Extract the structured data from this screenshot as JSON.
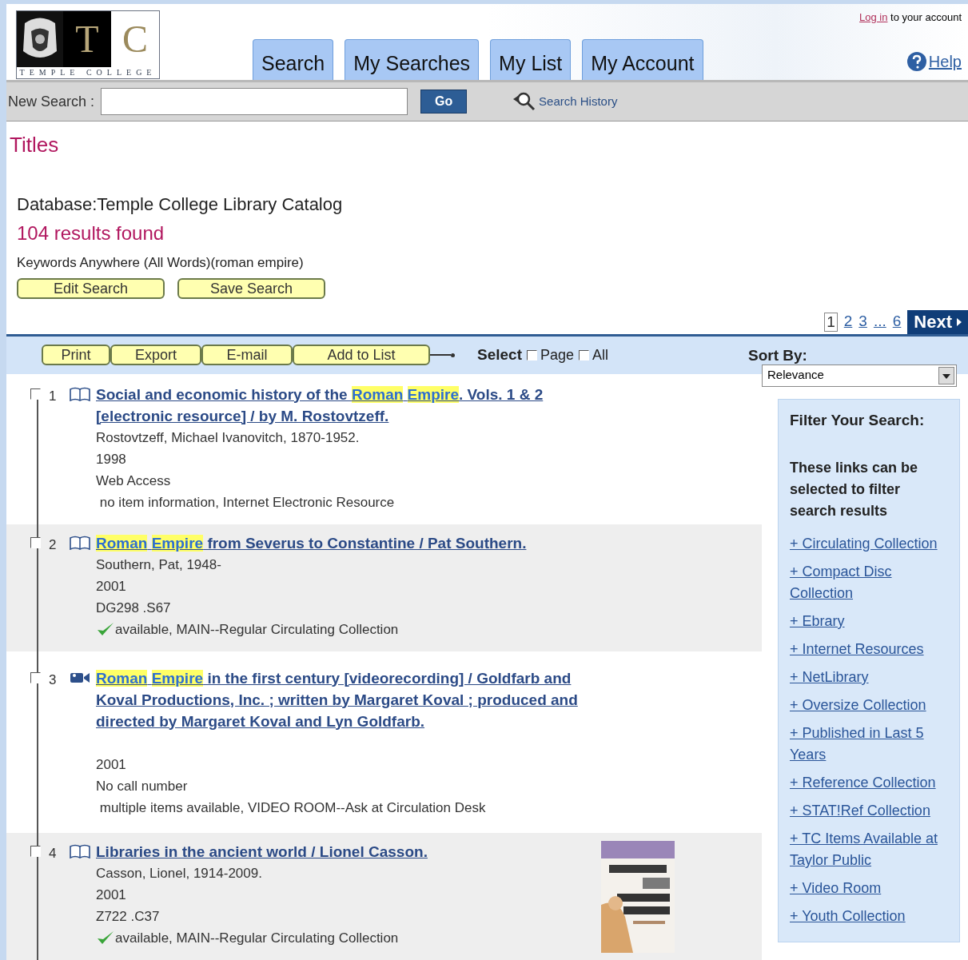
{
  "header": {
    "logo": {
      "initials": [
        "T",
        "C"
      ],
      "name": "TEMPLE COLLEGE"
    },
    "login_link": "Log in",
    "login_text": "to your account",
    "help": "Help"
  },
  "tabs": [
    {
      "label": "Search"
    },
    {
      "label": "My Searches"
    },
    {
      "label": "My List"
    },
    {
      "label": "My Account"
    }
  ],
  "search_bar": {
    "label": "New Search :",
    "go": "Go",
    "history": "Search History"
  },
  "page_title": "Titles",
  "database": "Database:Temple College Library Catalog",
  "results_count": "104 results found",
  "query": "Keywords Anywhere (All Words)(roman empire)",
  "query_buttons": [
    "Edit Search",
    "Save Search"
  ],
  "pagination": {
    "pages": [
      {
        "label": "1",
        "selected": true
      },
      {
        "label": "2",
        "selected": false
      },
      {
        "label": "3",
        "selected": false
      },
      {
        "label": "...",
        "selected": false
      },
      {
        "label": "6",
        "selected": false
      }
    ],
    "next": "Next"
  },
  "toolbar": {
    "actions": [
      "Print",
      "Export",
      "E-mail",
      "Add to List"
    ],
    "select_label": "Select",
    "checkboxes": [
      {
        "label": "Page",
        "checked": false
      },
      {
        "label": "All",
        "checked": false
      }
    ]
  },
  "sort": {
    "label": "Sort By:",
    "value": "Relevance"
  },
  "results": [
    {
      "number": "1",
      "kind": "book",
      "checked": false,
      "title": [
        {
          "text": "Social and economic history of the ",
          "highlighted": false
        },
        {
          "text": "Roman Empire",
          "highlighted": true
        },
        {
          "text": ". Vols. 1 & 2 [electronic resource] / by M. Rostovtzeff.",
          "highlighted": false
        }
      ],
      "lines": [
        "Rostovtzeff, Michael Ivanovitch, 1870-1952.",
        "1998",
        "Web Access"
      ],
      "status": {
        "text": " no item information, Internet Electronic Resource",
        "available": false
      }
    },
    {
      "number": "2",
      "kind": "book",
      "checked": false,
      "title": [
        {
          "text": "Roman Empire",
          "highlighted": true
        },
        {
          "text": " from Severus to Constantine / Pat Southern.",
          "highlighted": false
        }
      ],
      "lines": [
        "Southern, Pat, 1948-",
        "2001",
        "DG298 .S67"
      ],
      "status": {
        "text": "available, MAIN--Regular Circulating Collection",
        "available": true
      }
    },
    {
      "number": "3",
      "kind": "video",
      "checked": false,
      "title": [
        {
          "text": "Roman Empire",
          "highlighted": true
        },
        {
          "text": " in the first century [videorecording] / Goldfarb and Koval Productions, Inc. ; written by Margaret Koval ; produced and directed by Margaret Koval and Lyn Goldfarb.",
          "highlighted": false
        }
      ],
      "lines": [
        "2001",
        "No call number"
      ],
      "gap": true,
      "status": {
        "text": " multiple items available, VIDEO ROOM--Ask at Circulation Desk",
        "available": false
      }
    },
    {
      "number": "4",
      "kind": "book",
      "checked": false,
      "cover": {
        "kind": "picture"
      },
      "title": [
        {
          "text": "Libraries in the ancient world / Lionel Casson.",
          "highlighted": false
        }
      ],
      "lines": [
        "Casson, Lionel, 1914-2009.",
        "2001",
        "Z722 .C37"
      ],
      "status": {
        "text": "available, MAIN--Regular Circulating Collection",
        "available": true
      }
    }
  ],
  "filter": {
    "title": "Filter Your Search:",
    "intro": "These links can be selected to filter search results",
    "links": [
      "+ Circulating Collection",
      "+ Compact Disc Collection",
      "+ Ebrary",
      "+ Internet Resources",
      "+ NetLibrary",
      "+ Oversize Collection",
      "+ Published in Last 5 Years",
      "+ Reference Collection",
      "+ STAT!Ref Collection",
      "+ TC Items Available at Taylor Public",
      "+ Video Room",
      "+ Youth Collection"
    ]
  }
}
